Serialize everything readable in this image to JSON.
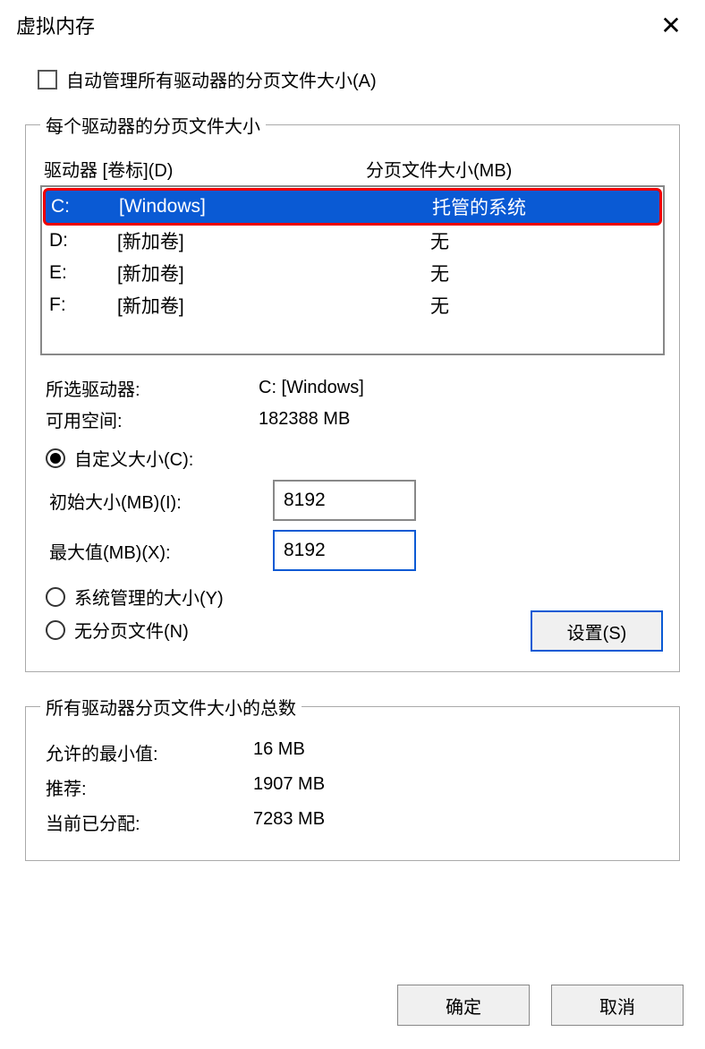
{
  "title": "虚拟内存",
  "auto_manage_label": "自动管理所有驱动器的分页文件大小(A)",
  "group1_legend": "每个驱动器的分页文件大小",
  "header_drive": "驱动器 [卷标](D)",
  "header_size": "分页文件大小(MB)",
  "drives": [
    {
      "letter": "C:",
      "label": "[Windows]",
      "size": "托管的系统",
      "selected": true
    },
    {
      "letter": "D:",
      "label": "[新加卷]",
      "size": "无",
      "selected": false
    },
    {
      "letter": "E:",
      "label": "[新加卷]",
      "size": "无",
      "selected": false
    },
    {
      "letter": "F:",
      "label": "[新加卷]",
      "size": "无",
      "selected": false
    }
  ],
  "selected_drive_label": "所选驱动器:",
  "selected_drive_value": "C: [Windows]",
  "free_space_label": "可用空间:",
  "free_space_value": "182388 MB",
  "radio_custom": "自定义大小(C):",
  "initial_size_label": "初始大小(MB)(I):",
  "initial_size_value": "8192",
  "max_size_label": "最大值(MB)(X):",
  "max_size_value": "8192",
  "radio_system": "系统管理的大小(Y)",
  "radio_none": "无分页文件(N)",
  "set_button": "设置(S)",
  "group2_legend": "所有驱动器分页文件大小的总数",
  "min_allowed_label": "允许的最小值:",
  "min_allowed_value": "16 MB",
  "recommended_label": "推荐:",
  "recommended_value": "1907 MB",
  "current_label": "当前已分配:",
  "current_value": "7283 MB",
  "ok_button": "确定",
  "cancel_button": "取消"
}
